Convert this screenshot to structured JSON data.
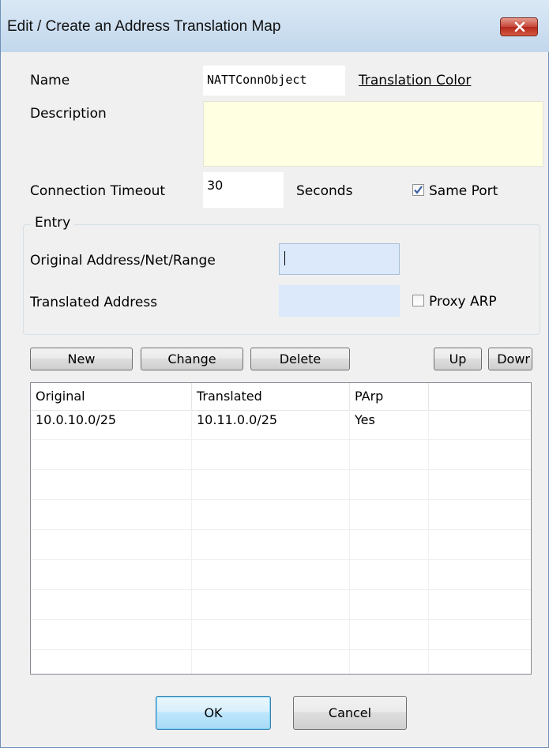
{
  "window": {
    "title": "Edit / Create an Address Translation Map"
  },
  "form": {
    "name_label": "Name",
    "name_value": "NATTConnObject",
    "translation_color_link": "Translation Color",
    "description_label": "Description",
    "description_value": "",
    "connection_timeout_label": "Connection Timeout",
    "connection_timeout_value": "30",
    "seconds_label": "Seconds",
    "same_port_label": "Same Port",
    "same_port_checked": true
  },
  "entry": {
    "group_title": "Entry",
    "original_label": "Original Address/Net/Range",
    "original_value": "",
    "translated_label": "Translated Address",
    "translated_value": "",
    "proxy_arp_label": "Proxy ARP",
    "proxy_arp_checked": false
  },
  "toolbar": {
    "new_label": "New",
    "change_label": "Change",
    "delete_label": "Delete",
    "up_label": "Up",
    "down_label": "Dowr"
  },
  "table": {
    "columns": [
      "Original",
      "Translated",
      "PArp",
      ""
    ],
    "rows": [
      [
        "10.0.10.0/25",
        "10.11.0.0/25",
        "Yes",
        ""
      ]
    ]
  },
  "footer": {
    "ok_label": "OK",
    "cancel_label": "Cancel"
  },
  "colors": {
    "description_bg": "#ffffe1",
    "entry_field_bg": "#dbe9fb",
    "titlebar": "#c2d7ec",
    "close_button": "#c6453a"
  }
}
